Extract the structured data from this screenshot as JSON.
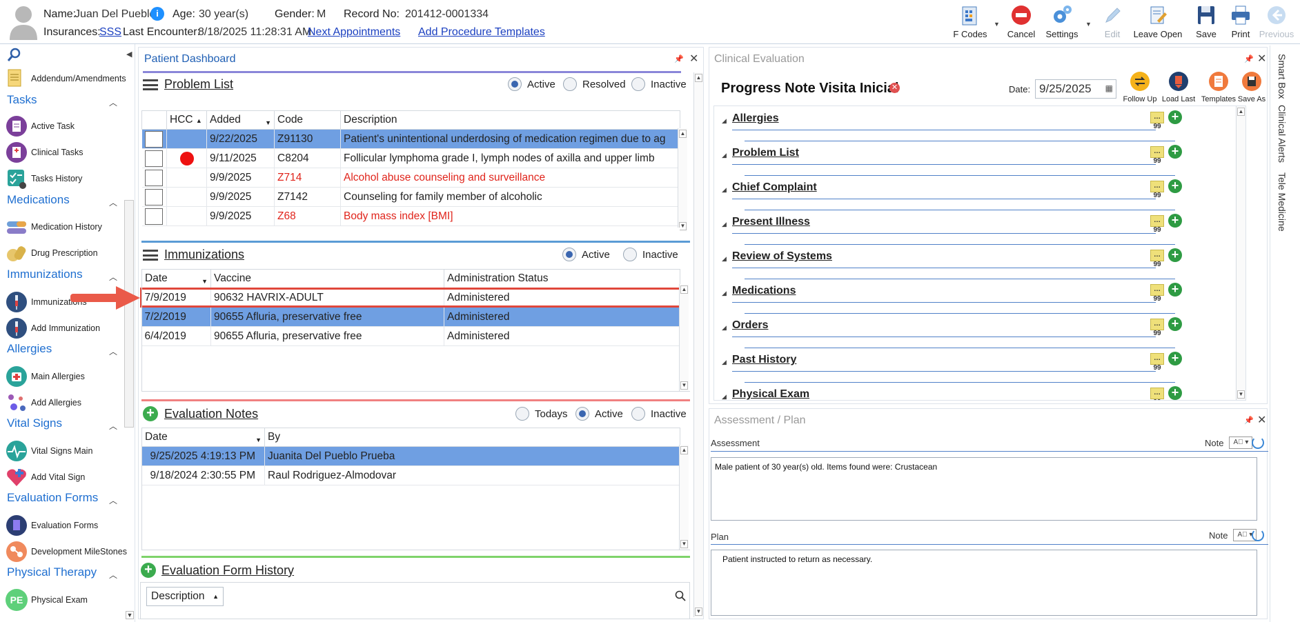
{
  "header": {
    "name_label": "Name:",
    "name_value": "Juan Del Pueblo",
    "age_label": "Age:",
    "age_value": "30 year(s)",
    "gender_label": "Gender:",
    "gender_value": "M",
    "record_label": "Record No:",
    "record_value": "201412-0001334",
    "insurances_label": "Insurances:",
    "insurance_link": "SSS",
    "last_encounter_label": "Last Encounter:",
    "last_encounter_value": "8/18/2025 11:28:31 AM",
    "next_appointments": "Next Appointments",
    "add_procedure_templates": "Add Procedure Templates"
  },
  "toolbar": {
    "fcodes": "F Codes",
    "cancel": "Cancel",
    "settings": "Settings",
    "edit": "Edit",
    "leave_open": "Leave Open",
    "save": "Save",
    "print": "Print",
    "previous": "Previous"
  },
  "sidebar": {
    "addendum": "Addendum/Amendments",
    "tasks": "Tasks",
    "active_task": "Active Task",
    "clinical_tasks": "Clinical Tasks",
    "tasks_history": "Tasks History",
    "medications": "Medications",
    "medication_history": "Medication History",
    "drug_prescription": "Drug Prescription",
    "immunizations": "Immunizations",
    "immunizations_item": "Immunizations",
    "add_immunization": "Add Immunization",
    "allergies": "Allergies",
    "main_allergies": "Main Allergies",
    "add_allergies": "Add Allergies",
    "vital_signs": "Vital Signs",
    "vital_signs_main": "Vital Signs Main",
    "add_vital_sign": "Add Vital Sign",
    "evaluation_forms": "Evaluation Forms",
    "evaluation_forms_item": "Evaluation Forms",
    "development_milestones": "Development MileStones",
    "physical_therapy": "Physical Therapy",
    "physical_exam": "Physical Exam",
    "pe_badge": "PE"
  },
  "dashboard": {
    "title": "Patient Dashboard",
    "problem_list": {
      "title": "Problem List",
      "filters": [
        "Active",
        "Resolved",
        "Inactive"
      ],
      "columns": [
        "HCC",
        "Added",
        "Code",
        "Description"
      ],
      "rows": [
        {
          "added": "9/22/2025",
          "code": "Z91130",
          "desc": "Patient's unintentional underdosing of medication regimen due to ag"
        },
        {
          "added": "9/11/2025",
          "code": "C8204",
          "desc": "Follicular lymphoma grade I, lymph nodes of axilla and upper limb"
        },
        {
          "added": "9/9/2025",
          "code": "Z714",
          "desc": "Alcohol abuse counseling and surveillance"
        },
        {
          "added": "9/9/2025",
          "code": "Z7142",
          "desc": "Counseling for family member of alcoholic"
        },
        {
          "added": "9/9/2025",
          "code": "Z68",
          "desc": "Body mass index [BMI]"
        }
      ]
    },
    "immunizations": {
      "title": "Immunizations",
      "filters": [
        "Active",
        "Inactive"
      ],
      "columns": [
        "Date",
        "Vaccine",
        "Administration Status"
      ],
      "rows": [
        {
          "date": "7/9/2019",
          "vaccine": "90632 HAVRIX-ADULT",
          "status": "Administered"
        },
        {
          "date": "7/2/2019",
          "vaccine": "90655 Afluria, preservative free",
          "status": "Administered"
        },
        {
          "date": "6/4/2019",
          "vaccine": "90655 Afluria, preservative free",
          "status": "Administered"
        }
      ]
    },
    "evaluation_notes": {
      "title": "Evaluation Notes",
      "filters": [
        "Todays",
        "Active",
        "Inactive"
      ],
      "columns": [
        "Date",
        "By"
      ],
      "rows": [
        {
          "date": "9/25/2025 4:19:13 PM",
          "by": "Juanita Del Pueblo Prueba"
        },
        {
          "date": "9/18/2024 2:30:55 PM",
          "by": "Raul Rodriguez-Almodovar"
        }
      ]
    },
    "evaluation_form_history": {
      "title": "Evaluation Form History",
      "column": "Description"
    }
  },
  "clinical": {
    "title": "Clinical Evaluation",
    "note_title": "Progress Note Visita Inicial",
    "date_label": "Date:",
    "date_value": "9/25/2025",
    "actions": [
      "Follow Up",
      "Load Last",
      "Templates",
      "Save As"
    ],
    "sections": [
      "Allergies",
      "Problem List",
      "Chief Complaint",
      "Present Illness",
      "Review of Systems",
      "Medications",
      "Orders",
      "Past History",
      "Physical Exam"
    ]
  },
  "assessment": {
    "title": "Assessment / Plan",
    "assessment_label": "Assessment",
    "note_label": "Note",
    "assessment_text": "Male patient of 30 year(s) old. Items found were:  Crustacean",
    "plan_label": "Plan",
    "plan_text": "Patient instructed to return as necessary."
  },
  "side_tabs": [
    "Smart Box",
    "Clinical Alerts",
    "Tele Medicine"
  ],
  "colors": {
    "accent": "#1f6fd0",
    "selected_row": "#6f9fe2",
    "red_code": "#e0241b",
    "highlight_box": "#e0473b"
  }
}
